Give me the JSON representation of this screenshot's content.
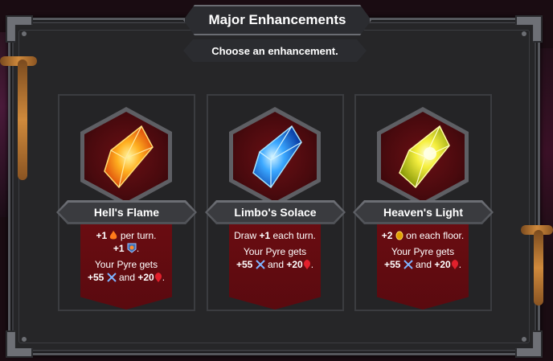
{
  "header": {
    "title": "Major Enhancements",
    "subtitle": "Choose an enhancement."
  },
  "cards": [
    {
      "name": "Hell's Flame",
      "gem_icon": "fire-gem-icon",
      "gem_color": "#ff7a1a",
      "line1_value": "+1",
      "line1_suffix": "per turn.",
      "line2_value": "+1",
      "line2_suffix": ".",
      "pyre_text": "Your Pyre gets",
      "attack_bonus": "+55",
      "and_text": "and",
      "health_bonus": "+20",
      "end_text": "."
    },
    {
      "name": "Limbo's Solace",
      "gem_icon": "ice-gem-icon",
      "gem_color": "#2f9cff",
      "line1_prefix": "Draw",
      "line1_value": "+1",
      "line1_suffix": "each turn.",
      "pyre_text": "Your Pyre gets",
      "attack_bonus": "+55",
      "and_text": "and",
      "health_bonus": "+20",
      "end_text": "."
    },
    {
      "name": "Heaven's Light",
      "gem_icon": "light-gem-icon",
      "gem_color": "#f2ef2a",
      "line1_value": "+2",
      "line1_suffix": "on each floor.",
      "pyre_text": "Your Pyre gets",
      "attack_bonus": "+55",
      "and_text": "and",
      "health_bonus": "+20",
      "end_text": "."
    }
  ],
  "colors": {
    "panel": "#262628",
    "banner_red": "#6d0d12",
    "attack_icon": "#7fb4ff",
    "health_icon": "#e2202c",
    "ember_icon": "#ff7a1a",
    "gold_icon": "#e0a000"
  }
}
